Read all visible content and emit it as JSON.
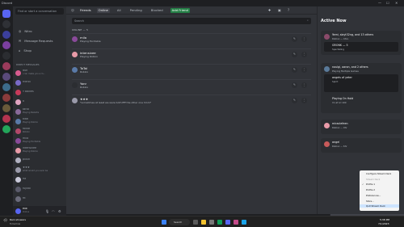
{
  "window": {
    "title": "Discord",
    "controls": [
      "—",
      "☐",
      "✕"
    ]
  },
  "servers": {
    "colors": [
      "#5865f2",
      "#2f3136",
      "#3b3f9c",
      "#7b3fa0",
      "#2b2d31",
      "#9a3b5b",
      "#5a4a7a",
      "#3c6b8a",
      "#8a3b3b",
      "#6a5a3a",
      "#b3344f",
      "#23a55a"
    ]
  },
  "dm_sidebar": {
    "search_placeholder": "Find or start a conversation",
    "nav": [
      {
        "label": "Friends",
        "icon": "friends-icon",
        "active": true
      },
      {
        "label": "Nitro",
        "icon": "nitro-icon",
        "active": false
      },
      {
        "label": "Message Requests",
        "icon": "mail-icon",
        "active": false
      },
      {
        "label": "Shop",
        "icon": "shop-icon",
        "active": false
      }
    ],
    "direct_messages_header": "DIRECT MESSAGES",
    "dms": [
      {
        "name": "duh",
        "sub": "i can make you a m...",
        "color": "#d85c8f"
      },
      {
        "name": "friend",
        "sub": "",
        "color": "#7a6ac8"
      },
      {
        "name": "Y bbikes",
        "sub": "",
        "color": "#c83a5a"
      },
      {
        "name": "ti",
        "sub": "",
        "color": "#e0a3c0"
      },
      {
        "name": "tarot",
        "sub": "Playing Bellette",
        "color": "#8a6a9a"
      },
      {
        "name": "tidal",
        "sub": "Playing Roblox",
        "color": "#5a7aa8"
      },
      {
        "name": "foxiar",
        "sub": "Roblox",
        "color": "#b3486a"
      },
      {
        "name": "mila",
        "sub": "Playing Excitable",
        "color": "#8a4a9a"
      },
      {
        "name": "intensivee",
        "sub": "Playing Roblox",
        "color": "#e89aa8"
      },
      {
        "name": "plush",
        "sub": "",
        "color": "#b0b0c0"
      },
      {
        "name": "★★★",
        "sub": "what would you ever be",
        "color": "#9a9aaa"
      },
      {
        "name": "fia",
        "sub": "",
        "color": "#c8c8d8"
      },
      {
        "name": "fujikai",
        "sub": "",
        "color": "#5a5a6a"
      },
      {
        "name": "ftt",
        "sub": "",
        "color": "#6a6a7a"
      },
      {
        "name": "ellerer",
        "sub": "",
        "color": "#7a7a8a"
      }
    ]
  },
  "user_panel": {
    "name": "elik",
    "status": "Online"
  },
  "friends": {
    "header_title": "Friends",
    "tabs": [
      {
        "label": "Online",
        "selected": true
      },
      {
        "label": "All",
        "selected": false
      },
      {
        "label": "Pending",
        "selected": false
      },
      {
        "label": "Blocked",
        "selected": false
      },
      {
        "label": "Add Friend",
        "selected": false,
        "accent": true
      }
    ],
    "search_placeholder": "Search",
    "online_count_label": "ONLINE — 5",
    "list": [
      {
        "name": "mila",
        "status": "Playing Excitable",
        "color": "#8a4a9a"
      },
      {
        "name": "intensivee",
        "status": "Playing Roblox",
        "color": "#e89aa8"
      },
      {
        "name": "ToTal",
        "status": "Roblox",
        "color": "#5a7aa8"
      },
      {
        "name": "Yonr",
        "status": "Roblox",
        "color": "#2b2d31"
      },
      {
        "name": "★★★",
        "status": "*sometimes at least we were both ffff the other one hmm*",
        "color": "#9a9aaa"
      }
    ]
  },
  "active_now": {
    "title": "Active Now",
    "cards": [
      {
        "title": "Yami, slayt32ng, and 13 others",
        "sub": "Roblox — 4hrs",
        "detail": "GRONK — 5",
        "detail2": "Spectating",
        "color": "#8a4a6a"
      },
      {
        "title": "noulgi, aaron, and 2 others",
        "sub": "Playing Multiple Games",
        "detail": "angels of yeter",
        "detail2": "Spirit",
        "extra": "Playing On Hold",
        "extra2": "Im at lvl 100",
        "color": "#5a7a9a"
      },
      {
        "title": "miraclefeen",
        "sub": "Roblox — 9hr",
        "color": "#e89aa8"
      },
      {
        "title": "angel",
        "sub": "Roblox — 6hr",
        "color": "#c85a5a"
      }
    ]
  },
  "tray_menu": {
    "items": [
      "Configure Stream Deck",
      "Stream Deck",
      "Profile 1",
      "Profile 2",
      "Preferences...",
      "Store...",
      "Quit Stream Deck"
    ],
    "checked_index": 2,
    "highlighted_index": 6
  },
  "taskbar": {
    "tray_title": "Rain showers",
    "tray_sub": "Tomorrow",
    "search_label": "Search",
    "time": "5:38 PM",
    "date": "7/1/2023"
  }
}
